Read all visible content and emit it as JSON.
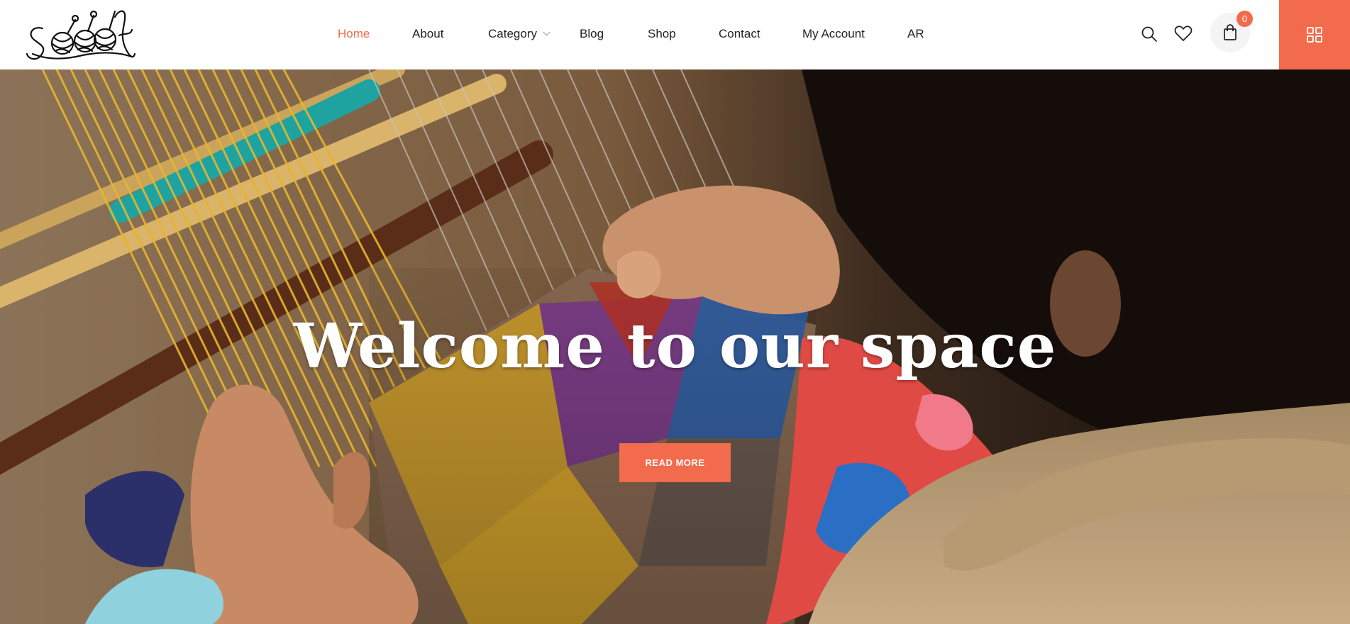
{
  "brand": {
    "logo_text": "Sook"
  },
  "nav": {
    "items": [
      {
        "label": "Home",
        "active": true
      },
      {
        "label": "About"
      },
      {
        "label": "Category",
        "has_dropdown": true
      },
      {
        "label": "Blog"
      },
      {
        "label": "Shop"
      },
      {
        "label": "Contact"
      },
      {
        "label": "My Account"
      },
      {
        "label": "AR"
      }
    ]
  },
  "header_actions": {
    "search_icon": "search-icon",
    "wishlist_icon": "heart-icon",
    "cart_icon": "shopping-bag-icon",
    "cart_count": "0",
    "menu_icon": "grid-icon"
  },
  "hero": {
    "title": "Welcome to our space",
    "button_label": "READ MORE"
  },
  "colors": {
    "accent": "#f26b4c",
    "nav_text": "#222222",
    "white": "#ffffff"
  }
}
